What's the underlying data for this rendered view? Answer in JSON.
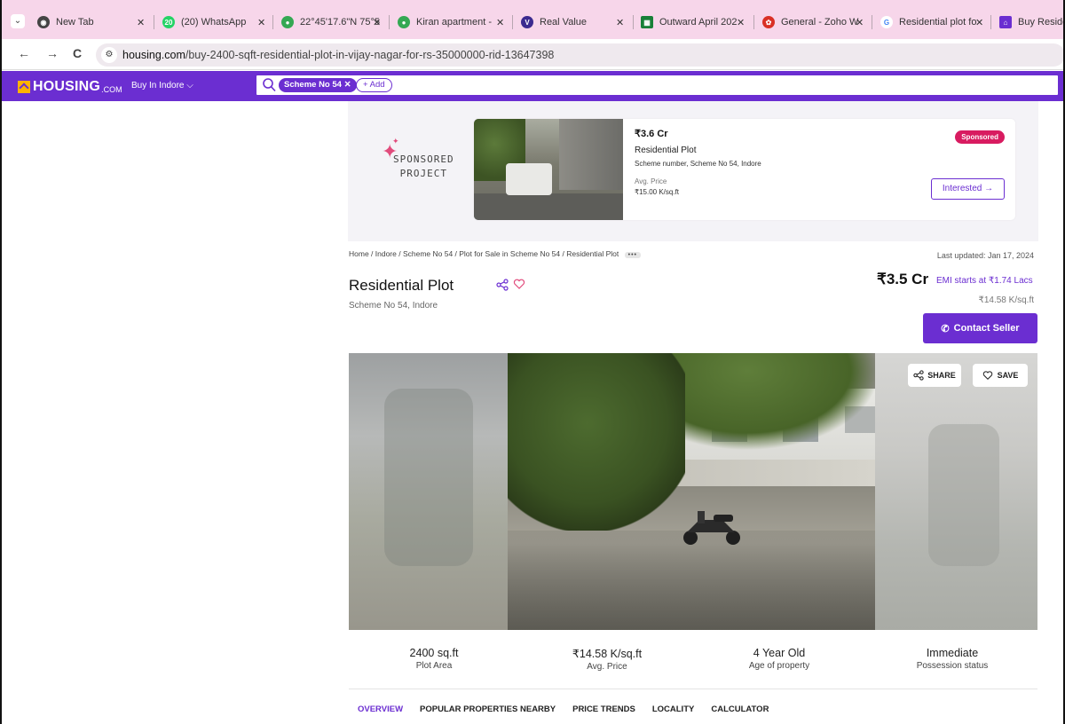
{
  "browser": {
    "tabs": [
      {
        "title": "New Tab",
        "color": "#444444"
      },
      {
        "title": "(20) WhatsApp",
        "color": "#25d366"
      },
      {
        "title": "22°45'17.6\"N 75°5",
        "color": "#34a853"
      },
      {
        "title": "Kiran apartment -",
        "color": "#34a853"
      },
      {
        "title": "Real Value",
        "color": "#3b2a8f"
      },
      {
        "title": "Outward April 202",
        "color": "#188038"
      },
      {
        "title": "General - Zoho W",
        "color": "#d93025"
      },
      {
        "title": "Residential plot fo",
        "color": "#4285f4"
      },
      {
        "title": "Buy Residenti",
        "color": "#6b2ed1"
      }
    ],
    "url_domain": "housing.com",
    "url_path": "/buy-2400-sqft-residential-plot-in-vijay-nagar-for-rs-35000000-rid-13647398"
  },
  "header": {
    "logo_text": "HOUSING",
    "logo_suffix": ".COM",
    "city_selector": "Buy In Indore",
    "search_chip": "Scheme No 54",
    "add_label": "+ Add"
  },
  "sponsored": {
    "title_line1": "SPONSORED",
    "title_line2": "PROJECT",
    "price": "₹3.6 Cr",
    "type": "Residential Plot",
    "location": "Scheme number, Scheme No 54, Indore",
    "avg_label": "Avg. Price",
    "avg_value": "₹15.00 K/sq.ft",
    "badge": "Sponsored",
    "button": "Interested →"
  },
  "listing": {
    "breadcrumb": "Home / Indore / Scheme No 54 / Plot for Sale in Scheme No 54 / Residential Plot",
    "breadcrumb_more": "•••",
    "last_updated": "Last updated: Jan 17, 2024",
    "title": "Residential Plot",
    "location": "Scheme No 54, Indore",
    "price": "₹3.5 Cr",
    "emi": "EMI starts at ₹1.74 Lacs",
    "price_per_sqft": "₹14.58 K/sq.ft",
    "contact_button": "Contact Seller",
    "share_label": "SHARE",
    "save_label": "SAVE"
  },
  "stats": [
    {
      "value": "2400 sq.ft",
      "label": "Plot Area"
    },
    {
      "value": "₹14.58 K/sq.ft",
      "label": "Avg. Price"
    },
    {
      "value": "4 Year Old",
      "label": "Age of property"
    },
    {
      "value": "Immediate",
      "label": "Possession status"
    }
  ],
  "section_tabs": [
    {
      "label": "OVERVIEW",
      "active": true
    },
    {
      "label": "POPULAR PROPERTIES NEARBY",
      "active": false
    },
    {
      "label": "PRICE TRENDS",
      "active": false
    },
    {
      "label": "LOCALITY",
      "active": false
    },
    {
      "label": "CALCULATOR",
      "active": false
    }
  ],
  "colors": {
    "brand": "#6b2ed1",
    "tabbar": "#f7d6ea",
    "sponsored_badge": "#d81b60"
  }
}
